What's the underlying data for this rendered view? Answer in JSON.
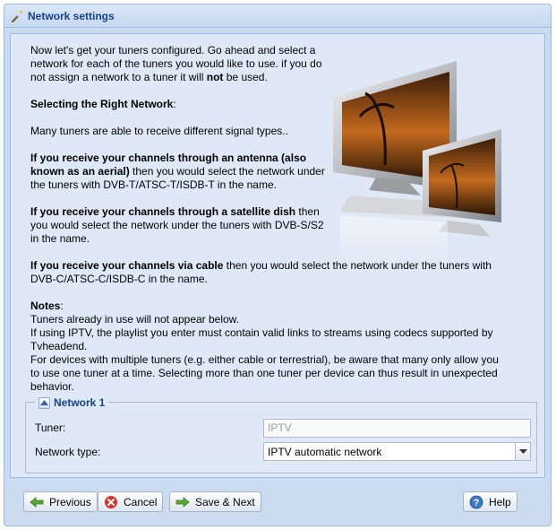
{
  "window": {
    "title": "Network settings",
    "title_icon": "magic-wand-icon"
  },
  "intro": {
    "paragraph1": "Now let's get your tuners configured. Go ahead and select a network for each of the tuners you would like to use. if you do not assign a network to a tuner it will ",
    "paragraph1_bold": "not",
    "paragraph1_end": " be used.",
    "heading": "Selecting the Right Network",
    "heading_suffix": ":",
    "types_line": "Many tuners are able to receive different signal types..",
    "antenna_bold": "If you receive your channels through an antenna (also known as an aerial)",
    "antenna_rest": " then you would select the network under the tuners with DVB-T/ATSC-T/ISDB-T in the name.",
    "satellite_bold": "If you receive your channels through a satellite dish",
    "satellite_rest": " then you would select the network under the tuners with DVB-S/S2 in the name.",
    "cable_bold": "If you receive your channels via cable",
    "cable_rest": " then you would select the network under the tuners with DVB-C/ATSC-C/ISDB-C in the name.",
    "notes_heading": "Notes",
    "notes_suffix": ":",
    "note1": "Tuners already in use will not appear below.",
    "note2": "If using IPTV, the playlist you enter must contain valid links to streams using codecs supported by Tvheadend.",
    "note3": "For devices with multiple tuners (e.g. either cable or terrestrial), be aware that many only allow you to use one tuner at a time. Selecting more than one tuner per device can thus result in unexpected behavior."
  },
  "network_section": {
    "legend": "Network 1",
    "tuner_label": "Tuner:",
    "tuner_value": "IPTV",
    "network_type_label": "Network type:",
    "network_type_value": "IPTV automatic network"
  },
  "buttons": {
    "previous": "Previous",
    "cancel": "Cancel",
    "save_next": "Save & Next",
    "help": "Help"
  },
  "colors": {
    "title_text": "#15428b",
    "panel_bg": "#dfe8f6",
    "window_bg": "#cbdcf0",
    "border": "#99bbe8"
  }
}
